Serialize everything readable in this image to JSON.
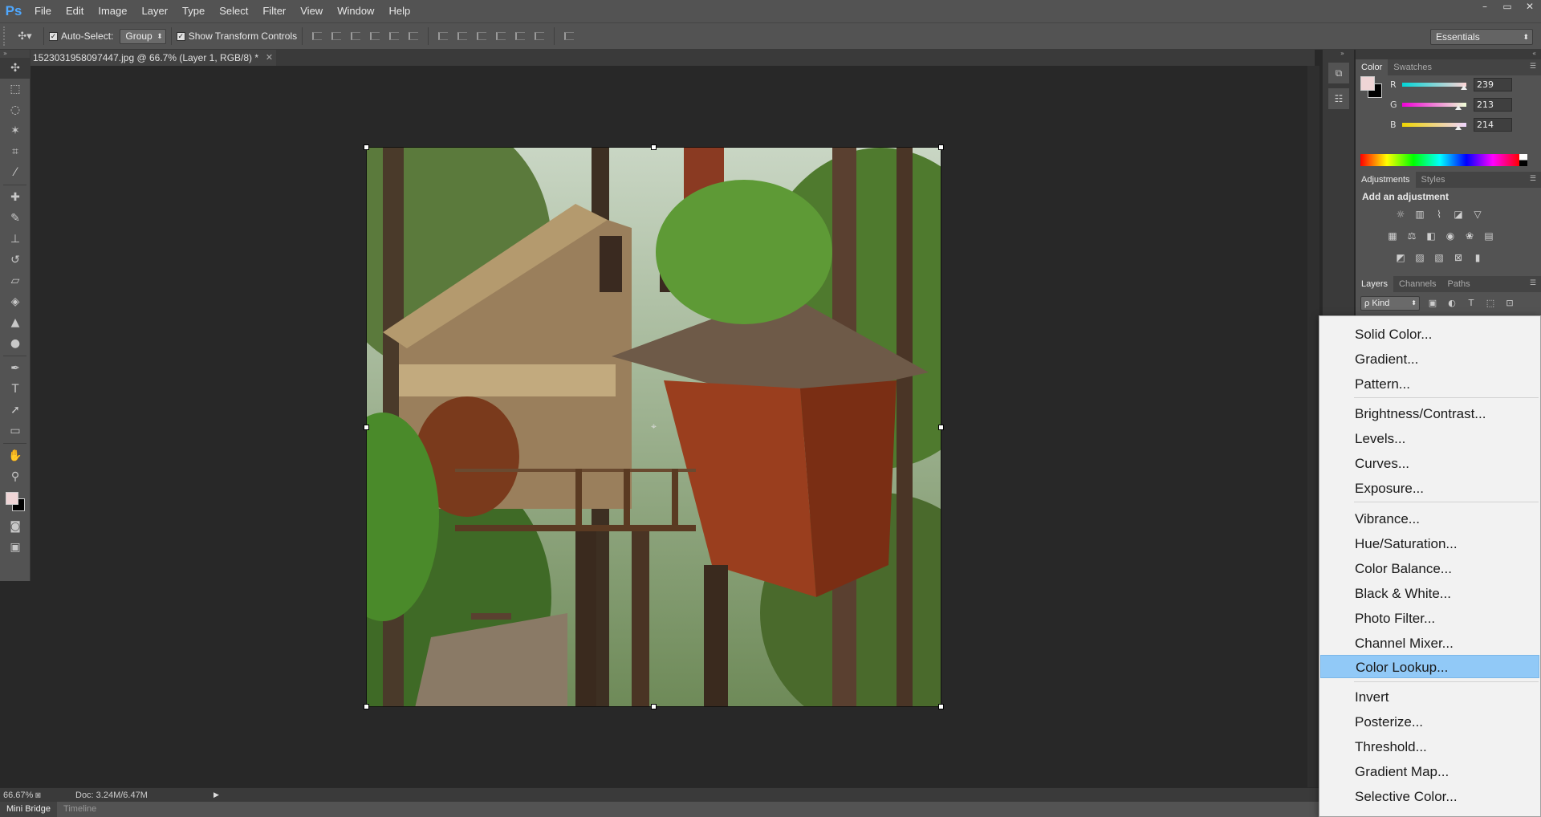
{
  "app": {
    "logo": "Ps"
  },
  "menubar": {
    "items": [
      "File",
      "Edit",
      "Image",
      "Layer",
      "Type",
      "Select",
      "Filter",
      "View",
      "Window",
      "Help"
    ],
    "window_controls": [
      "–",
      "▭",
      "✕"
    ]
  },
  "options": {
    "auto_select_label": "Auto-Select:",
    "auto_select_checked": true,
    "auto_select_value": "Group",
    "transform_label": "Show Transform Controls",
    "transform_checked": true,
    "workspace": "Essentials"
  },
  "document": {
    "tab_title": "1523031958097447.jpg @ 66.7% (Layer 1, RGB/8) *",
    "close": "✕"
  },
  "status": {
    "zoom": "66.67%",
    "doc_info": "Doc: 3.24M/6.47M"
  },
  "bottom_tabs": [
    "Mini Bridge",
    "Timeline"
  ],
  "color_panel": {
    "tabs": [
      "Color",
      "Swatches"
    ],
    "foreground": "#efd5d6",
    "background": "#000000",
    "r_label": "R",
    "r": "239",
    "g_label": "G",
    "g": "213",
    "b_label": "B",
    "b": "214"
  },
  "adjustments_panel": {
    "tabs": [
      "Adjustments",
      "Styles"
    ],
    "title": "Add an adjustment",
    "icons": [
      [
        "brightness-icon",
        "levels-icon",
        "curves-icon",
        "exposure-icon",
        "vibrance-icon"
      ],
      [
        "hue-saturation-icon",
        "color-balance-icon",
        "black-white-icon",
        "photo-filter-icon",
        "channel-mixer-icon",
        "color-lookup-icon"
      ],
      [
        "invert-icon",
        "posterize-icon",
        "threshold-icon",
        "selective-color-icon",
        "gradient-map-icon"
      ]
    ]
  },
  "layers_panel": {
    "tabs": [
      "Layers",
      "Channels",
      "Paths"
    ],
    "kind": "ρ Kind"
  },
  "adjustment_menu": {
    "groups": [
      [
        "Solid Color...",
        "Gradient...",
        "Pattern..."
      ],
      [
        "Brightness/Contrast...",
        "Levels...",
        "Curves...",
        "Exposure..."
      ],
      [
        "Vibrance...",
        "Hue/Saturation...",
        "Color Balance...",
        "Black & White...",
        "Photo Filter...",
        "Channel Mixer...",
        "Color Lookup..."
      ],
      [
        "Invert",
        "Posterize...",
        "Threshold...",
        "Gradient Map...",
        "Selective Color..."
      ]
    ],
    "highlighted": "Color Lookup..."
  }
}
